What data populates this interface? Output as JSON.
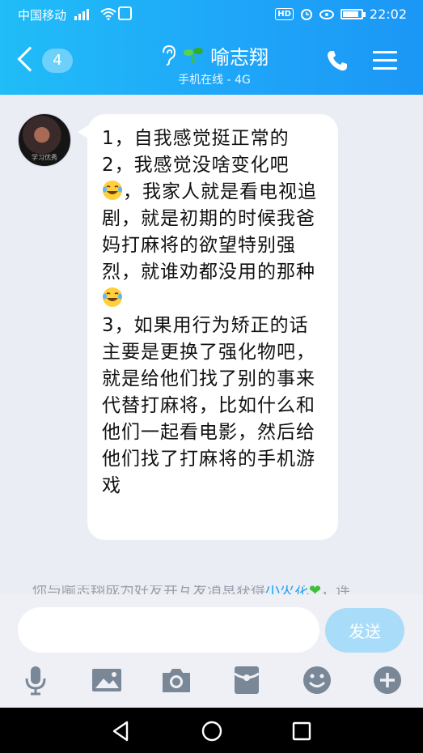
{
  "status_bar": {
    "carrier": "中国移动",
    "network": "4G",
    "hd": "HD",
    "time": "22:02"
  },
  "header": {
    "back_badge": "4",
    "contact_name": "喻志翔",
    "subtitle": "手机在线 - 4G"
  },
  "avatar_text": "学习优秀",
  "message": {
    "line_1": "1，自我感觉挺正常的",
    "line_2": "2，我感觉没啥变化吧",
    "line_3_after_emoji": "，我家人就是看电视追剧，就是初期的时候我爸妈打麻将的欲望特别强烈，就谁劝都没用的那种",
    "line_4": "3，如果用行为矫正的话主要是更换了强化物吧，就是给他们找了别的事来代替打麻将，比如什么和他们一起看电影，然后给他们找了打麻将的手机游戏"
  },
  "system_note": {
    "prefix": "你与喻志翔成为好友并互发消息获得",
    "highlight": "小火花",
    "suffix": "，连"
  },
  "input": {
    "placeholder": "",
    "send_label": "发送"
  },
  "colors": {
    "header_start": "#20bdf7",
    "header_end": "#1b97f5",
    "send_button": "#a8dcf8",
    "background": "#ebedf4"
  },
  "icons": [
    "mic-icon",
    "image-icon",
    "camera-icon",
    "red-packet-icon",
    "emoji-icon",
    "plus-icon"
  ]
}
